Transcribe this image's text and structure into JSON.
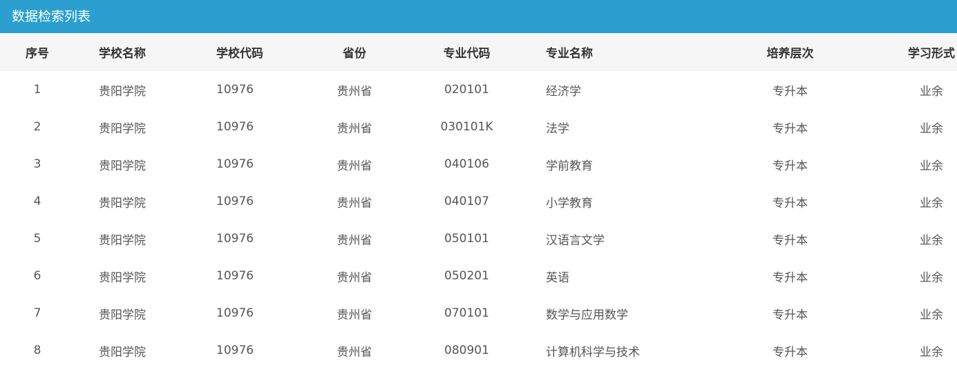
{
  "panel": {
    "title": "数据检索列表"
  },
  "table": {
    "columns": [
      "序号",
      "学校名称",
      "学校代码",
      "省份",
      "专业代码",
      "专业名称",
      "培养层次",
      "学习形式"
    ],
    "rows": [
      [
        "1",
        "贵阳学院",
        "10976",
        "贵州省",
        "020101",
        "经济学",
        "专升本",
        "业余"
      ],
      [
        "2",
        "贵阳学院",
        "10976",
        "贵州省",
        "030101K",
        "法学",
        "专升本",
        "业余"
      ],
      [
        "3",
        "贵阳学院",
        "10976",
        "贵州省",
        "040106",
        "学前教育",
        "专升本",
        "业余"
      ],
      [
        "4",
        "贵阳学院",
        "10976",
        "贵州省",
        "040107",
        "小学教育",
        "专升本",
        "业余"
      ],
      [
        "5",
        "贵阳学院",
        "10976",
        "贵州省",
        "050101",
        "汉语言文学",
        "专升本",
        "业余"
      ],
      [
        "6",
        "贵阳学院",
        "10976",
        "贵州省",
        "050201",
        "英语",
        "专升本",
        "业余"
      ],
      [
        "7",
        "贵阳学院",
        "10976",
        "贵州省",
        "070101",
        "数学与应用数学",
        "专升本",
        "业余"
      ],
      [
        "8",
        "贵阳学院",
        "10976",
        "贵州省",
        "080901",
        "计算机科学与技术",
        "专升本",
        "业余"
      ]
    ]
  },
  "colors": {
    "header_bg": "#2a9fd0",
    "table_head_bg": "#f6f6f6"
  }
}
